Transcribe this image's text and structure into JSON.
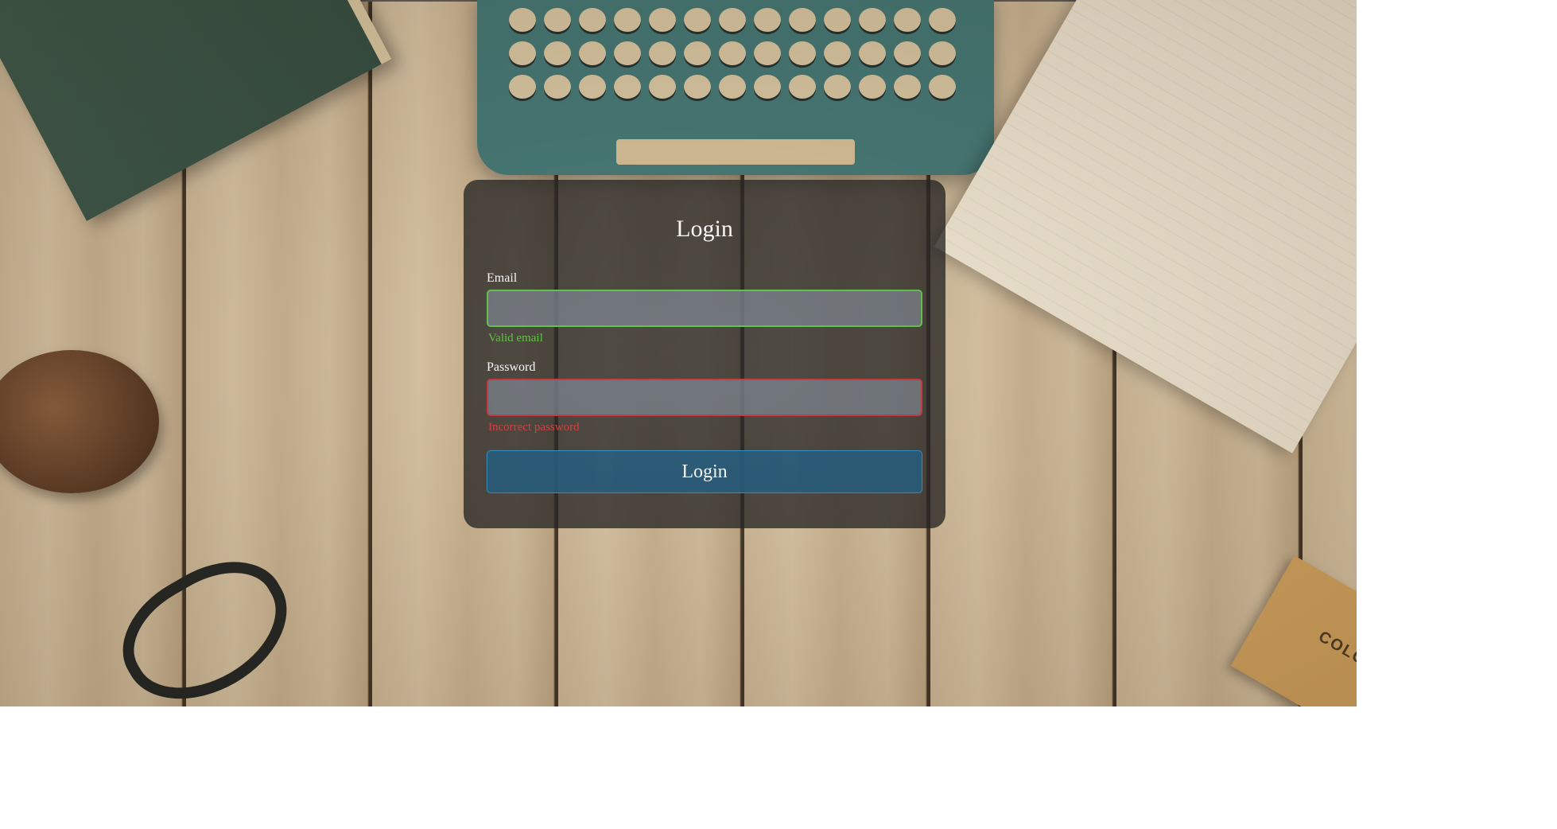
{
  "colors": {
    "valid": "#5ec246",
    "invalid": "#c8323a",
    "button_bg": "#1c5a80",
    "card_bg": "#1e1e1e"
  },
  "background": {
    "decor_text": "COLOR"
  },
  "login": {
    "title": "Login",
    "email": {
      "label": "Email",
      "value": "",
      "status": "Valid email"
    },
    "password": {
      "label": "Password",
      "value": "",
      "status": "Incorrect password"
    },
    "submit_label": "Login"
  }
}
